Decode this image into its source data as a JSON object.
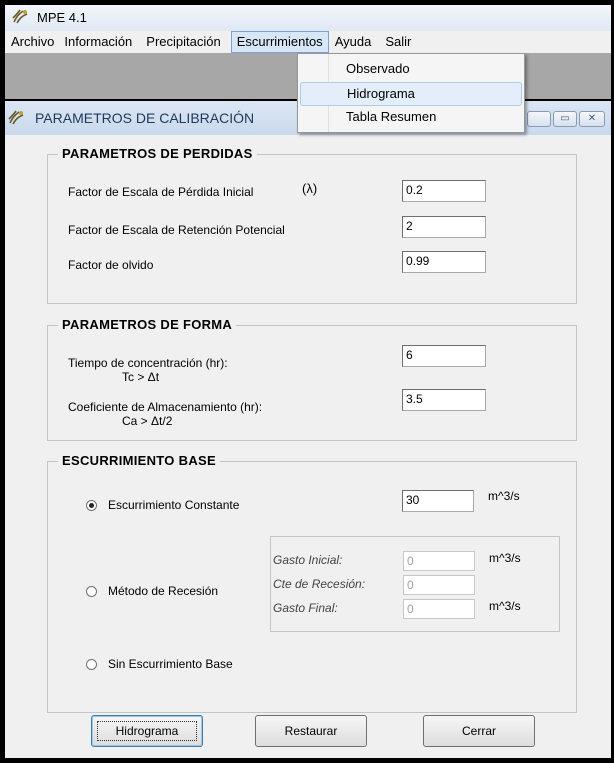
{
  "app": {
    "title": "MPE 4.1"
  },
  "menubar": {
    "items": [
      "Archivo",
      "Información",
      "Precipitación",
      "Escurrimientos",
      "Ayuda",
      "Salir"
    ],
    "open_index": 3
  },
  "dropdown": {
    "items": [
      "Observado",
      "Hidrograma",
      "Tabla Resumen"
    ],
    "hover_index": 1
  },
  "dialog": {
    "title": "PARAMETROS DE CALIBRACIÓN",
    "perdidas": {
      "title": "PARAMETROS DE PERDIDAS",
      "fields": [
        {
          "label": "Factor de Escala de Pérdida Inicial",
          "symbol": "(λ)",
          "value": "0.2"
        },
        {
          "label": "Factor de Escala de Retención Potencial",
          "value": "2"
        },
        {
          "label": "Factor de olvido",
          "value": "0.99"
        }
      ]
    },
    "forma": {
      "title": "PARAMETROS DE FORMA",
      "fields": [
        {
          "label": "Tiempo de concentración (hr):",
          "sublabel": "Tc > Δt",
          "value": "6"
        },
        {
          "label": "Coeficiente de Almacenamiento (hr):",
          "sublabel": "Ca > Δt/2",
          "value": "3.5"
        }
      ]
    },
    "base": {
      "title": "ESCURRIMIENTO BASE",
      "options": [
        {
          "label": "Escurrimiento Constante",
          "checked": true
        },
        {
          "label": "Método de Recesión",
          "checked": false
        },
        {
          "label": "Sin Escurrimiento Base",
          "checked": false
        }
      ],
      "constante": {
        "value": "30",
        "unit": "m^3/s"
      },
      "recesion": {
        "gasto_inicial": {
          "label": "Gasto Inicial:",
          "value": "0",
          "unit": "m^3/s"
        },
        "cte_recesion": {
          "label": "Cte de Recesión:",
          "value": "0"
        },
        "gasto_final": {
          "label": "Gasto Final:",
          "value": "0",
          "unit": "m^3/s"
        }
      }
    },
    "buttons": {
      "hidrograma": "Hidrograma",
      "restaurar": "Restaurar",
      "cerrar": "Cerrar"
    }
  }
}
